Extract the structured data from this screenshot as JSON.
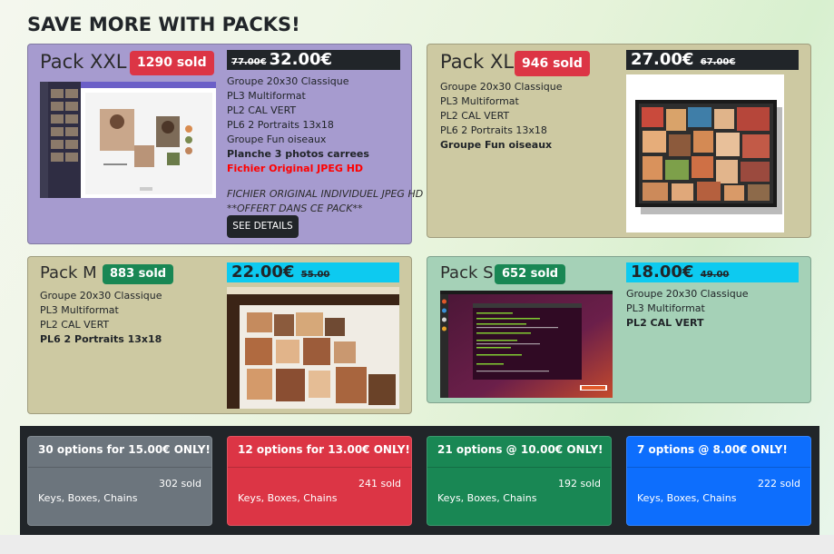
{
  "page_title": "SAVE MORE WITH PACKS!",
  "packs": {
    "xxl": {
      "title": "Pack XXL",
      "sold": "1290 sold",
      "old_price": "77.00€",
      "price": "32.00€",
      "features": [
        "Groupe 20x30 Classique",
        "PL3 Multiformat",
        "PL2 CAL VERT",
        "PL6 2 Portraits 13x18",
        "Groupe Fun oiseaux"
      ],
      "bold_features": [
        "Planche 3 photos carrees"
      ],
      "highlight_feature": "Fichier Original JPEG HD",
      "note_line1": "FICHIER ORIGINAL INDIVIDUEL JPEG HD",
      "note_line2": "**OFFERT DANS CE PACK**",
      "details_label": "SEE DETAILS"
    },
    "xl": {
      "title": "Pack XL",
      "sold": "946 sold",
      "price": "27.00€",
      "old_price": "67.00€",
      "features": [
        "Groupe 20x30 Classique",
        "PL3 Multiformat",
        "PL2 CAL VERT",
        "PL6 2 Portraits 13x18"
      ],
      "bold_features": [
        "Groupe Fun oiseaux"
      ]
    },
    "m": {
      "title": "Pack M",
      "sold": "883 sold",
      "price": "22.00€",
      "old_price": "55.00",
      "features": [
        "Groupe 20x30 Classique",
        "PL3 Multiformat",
        "PL2 CAL VERT"
      ],
      "bold_features": [
        "PL6 2 Portraits 13x18"
      ]
    },
    "s": {
      "title": "Pack S",
      "sold": "652 sold",
      "price": "18.00€",
      "old_price": "49.00",
      "features": [
        "Groupe 20x30 Classique",
        "PL3 Multiformat"
      ],
      "bold_features": [
        "PL2 CAL VERT"
      ]
    }
  },
  "offers": [
    {
      "title": "30 options for 15.00€ ONLY!",
      "sold": "302 sold",
      "items": "Keys, Boxes, Chains",
      "color": "#6c757d"
    },
    {
      "title": "12 options for 13.00€ ONLY!",
      "sold": "241 sold",
      "items": "Keys, Boxes, Chains",
      "color": "#dc3545"
    },
    {
      "title": "21 options @ 10.00€ ONLY!",
      "sold": "192 sold",
      "items": "Keys, Boxes, Chains",
      "color": "#198754"
    },
    {
      "title": "7 options @ 8.00€ ONLY!",
      "sold": "222 sold",
      "items": "Keys, Boxes, Chains",
      "color": "#0d6efd"
    }
  ],
  "colors": {
    "xxl_bg": "#a69bcf",
    "xl_bg": "#cdc9a2",
    "m_bg": "#cdc9a2",
    "s_bg": "#a5d1b7",
    "badge_red": "#dc3545",
    "badge_green": "#198754",
    "price_dark": "#212529",
    "price_cyan": "#0dcaf0",
    "highlight_red": "#ff0000"
  }
}
